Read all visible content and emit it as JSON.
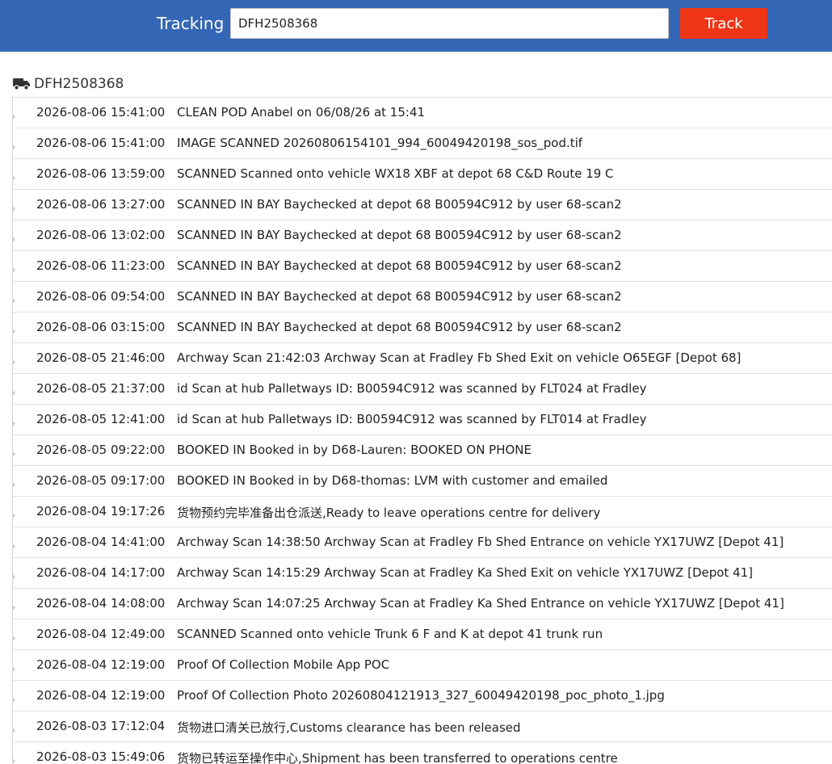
{
  "search": {
    "label": "Tracking",
    "value": "DFH2508368",
    "button_label": "Track"
  },
  "colors": {
    "header_bg": "#3366b5",
    "button_bg": "#ee3516"
  },
  "result": {
    "icon": "truck-icon",
    "tracking_number": "DFH2508368",
    "events": [
      {
        "time": "2026-08-06 15:41:00",
        "description": "CLEAN POD Anabel on 06/08/26 at 15:41"
      },
      {
        "time": "2026-08-06 15:41:00",
        "description": "IMAGE SCANNED 20260806154101_994_60049420198_sos_pod.tif"
      },
      {
        "time": "2026-08-06 13:59:00",
        "description": "SCANNED Scanned onto vehicle WX18 XBF at depot 68 C&D Route 19 C"
      },
      {
        "time": "2026-08-06 13:27:00",
        "description": "SCANNED IN BAY Baychecked at depot 68 B00594C912 by user 68-scan2"
      },
      {
        "time": "2026-08-06 13:02:00",
        "description": "SCANNED IN BAY Baychecked at depot 68 B00594C912 by user 68-scan2"
      },
      {
        "time": "2026-08-06 11:23:00",
        "description": "SCANNED IN BAY Baychecked at depot 68 B00594C912 by user 68-scan2"
      },
      {
        "time": "2026-08-06 09:54:00",
        "description": "SCANNED IN BAY Baychecked at depot 68 B00594C912 by user 68-scan2"
      },
      {
        "time": "2026-08-06 03:15:00",
        "description": "SCANNED IN BAY Baychecked at depot 68 B00594C912 by user 68-scan2"
      },
      {
        "time": "2026-08-05 21:46:00",
        "description": "Archway Scan 21:42:03 Archway Scan at Fradley Fb Shed Exit on vehicle O65EGF [Depot 68]"
      },
      {
        "time": "2026-08-05 21:37:00",
        "description": "id Scan at hub Palletways ID: B00594C912 was scanned by FLT024 at Fradley"
      },
      {
        "time": "2026-08-05 12:41:00",
        "description": "id Scan at hub Palletways ID: B00594C912 was scanned by FLT014 at Fradley"
      },
      {
        "time": "2026-08-05 09:22:00",
        "description": "BOOKED IN Booked in by D68-Lauren: BOOKED ON PHONE"
      },
      {
        "time": "2026-08-05 09:17:00",
        "description": "BOOKED IN Booked in by D68-thomas: LVM with customer and emailed"
      },
      {
        "time": "2026-08-04 19:17:26",
        "description": "货物预约完毕准备出仓派送,Ready to leave operations centre for delivery"
      },
      {
        "time": "2026-08-04 14:41:00",
        "description": "Archway Scan 14:38:50 Archway Scan at Fradley Fb Shed Entrance on vehicle YX17UWZ [Depot 41]"
      },
      {
        "time": "2026-08-04 14:17:00",
        "description": "Archway Scan 14:15:29 Archway Scan at Fradley Ka Shed Exit on vehicle YX17UWZ [Depot 41]"
      },
      {
        "time": "2026-08-04 14:08:00",
        "description": "Archway Scan 14:07:25 Archway Scan at Fradley Ka Shed Entrance on vehicle YX17UWZ [Depot 41]"
      },
      {
        "time": "2026-08-04 12:49:00",
        "description": "SCANNED Scanned onto vehicle Trunk 6 F and K at depot 41 trunk run"
      },
      {
        "time": "2026-08-04 12:19:00",
        "description": "Proof Of Collection Mobile App POC"
      },
      {
        "time": "2026-08-04 12:19:00",
        "description": "Proof Of Collection Photo 20260804121913_327_60049420198_poc_photo_1.jpg"
      },
      {
        "time": "2026-08-03 17:12:04",
        "description": "货物进口清关已放行,Customs clearance has been released"
      },
      {
        "time": "2026-08-03 15:49:06",
        "description": "货物已转运至操作中心,Shipment has been transferred to operations centre"
      }
    ]
  }
}
